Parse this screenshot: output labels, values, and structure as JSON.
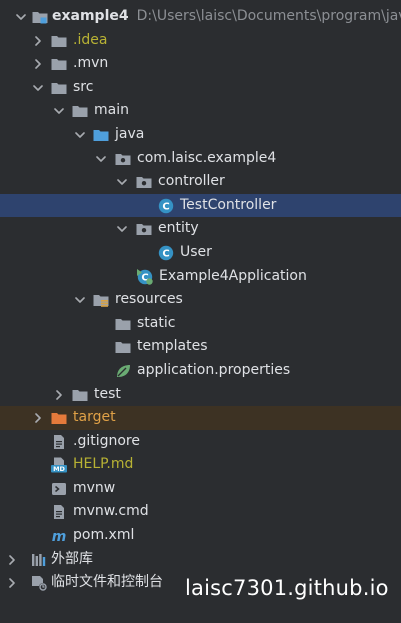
{
  "colors": {
    "background": "#2b2d30",
    "selected_row": "#2e436e",
    "excluded_row": "#3d3223",
    "text": "#dfe1e5",
    "path_text": "#8c8f94",
    "idea_text": "#b8b234",
    "excluded_text": "#e0a147",
    "folder_icon": "#9aa1ab",
    "source_folder_icon": "#4f9fdc",
    "class_icon": "#3592c4",
    "spring_icon": "#6aab73"
  },
  "tree": {
    "project": {
      "name": "example4",
      "path": "D:\\Users\\laisc\\Documents\\program\\java"
    },
    "rows": [
      {
        "label": ".idea",
        "icon": "folder-icon"
      },
      {
        "label": ".mvn",
        "icon": "folder-icon"
      },
      {
        "label": "src",
        "icon": "folder-icon"
      },
      {
        "label": "main",
        "icon": "folder-icon"
      },
      {
        "label": "java",
        "icon": "source-folder-icon"
      },
      {
        "label": "com.laisc.example4",
        "icon": "package-icon"
      },
      {
        "label": "controller",
        "icon": "package-icon"
      },
      {
        "label": "TestController",
        "icon": "java-class-icon"
      },
      {
        "label": "entity",
        "icon": "package-icon"
      },
      {
        "label": "User",
        "icon": "java-class-icon"
      },
      {
        "label": "Example4Application",
        "icon": "spring-boot-class-icon"
      },
      {
        "label": "resources",
        "icon": "resources-folder-icon"
      },
      {
        "label": "static",
        "icon": "folder-icon"
      },
      {
        "label": "templates",
        "icon": "folder-icon"
      },
      {
        "label": "application.properties",
        "icon": "spring-properties-icon"
      },
      {
        "label": "test",
        "icon": "folder-icon"
      },
      {
        "label": "target",
        "icon": "excluded-folder-icon"
      },
      {
        "label": ".gitignore",
        "icon": "text-file-icon"
      },
      {
        "label": "HELP.md",
        "icon": "markdown-file-icon"
      },
      {
        "label": "mvnw",
        "icon": "terminal-file-icon"
      },
      {
        "label": "mvnw.cmd",
        "icon": "text-file-icon"
      },
      {
        "label": "pom.xml",
        "icon": "maven-icon"
      },
      {
        "label": "外部库",
        "icon": "external-libraries-icon"
      },
      {
        "label": "临时文件和控制台",
        "icon": "scratches-icon"
      }
    ]
  },
  "watermark": "laisc7301.github.io"
}
